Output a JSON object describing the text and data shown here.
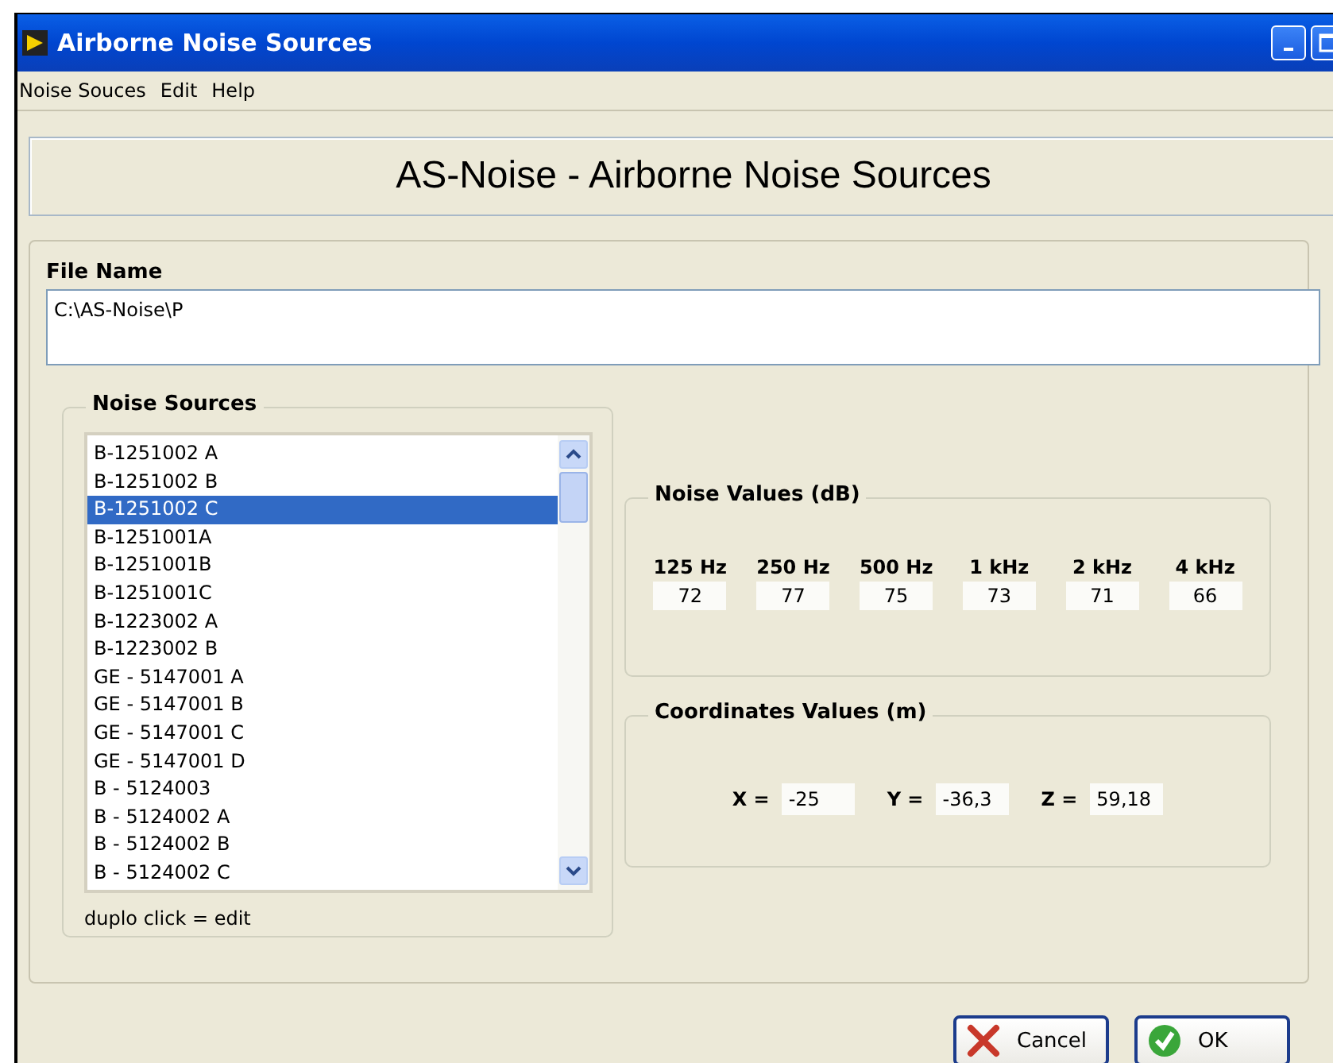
{
  "window": {
    "title": "Airborne Noise Sources"
  },
  "menu": [
    "Noise Souces",
    "Edit",
    "Help"
  ],
  "header": "AS-Noise - Airborne Noise Sources",
  "file_name": {
    "label": "File Name",
    "value": "C:\\AS-Noise\\P"
  },
  "noise_sources": {
    "title": "Noise Sources",
    "items": [
      {
        "label": "B-1251002 A",
        "selected": false
      },
      {
        "label": "B-1251002 B",
        "selected": false
      },
      {
        "label": "B-1251002 C",
        "selected": true
      },
      {
        "label": "B-1251001A",
        "selected": false
      },
      {
        "label": "B-1251001B",
        "selected": false
      },
      {
        "label": "B-1251001C",
        "selected": false
      },
      {
        "label": "B-1223002 A",
        "selected": false
      },
      {
        "label": "B-1223002 B",
        "selected": false
      },
      {
        "label": "GE - 5147001 A",
        "selected": false
      },
      {
        "label": "GE - 5147001 B",
        "selected": false
      },
      {
        "label": "GE - 5147001 C",
        "selected": false
      },
      {
        "label": "GE - 5147001 D",
        "selected": false
      },
      {
        "label": "B - 5124003",
        "selected": false
      },
      {
        "label": "B - 5124002 A",
        "selected": false
      },
      {
        "label": "B - 5124002 B",
        "selected": false
      },
      {
        "label": "B - 5124002 C",
        "selected": false
      }
    ],
    "hint": "duplo click = edit"
  },
  "noise_values": {
    "title": "Noise Values (dB)",
    "bands": [
      {
        "label": "125 Hz",
        "value": "72"
      },
      {
        "label": "250 Hz",
        "value": "77"
      },
      {
        "label": "500 Hz",
        "value": "75"
      },
      {
        "label": "1 kHz",
        "value": "73"
      },
      {
        "label": "2 kHz",
        "value": "71"
      },
      {
        "label": "4 kHz",
        "value": "66"
      }
    ]
  },
  "coordinates": {
    "title": "Coordinates Values (m)",
    "values": [
      {
        "label": "X =",
        "value": "-25"
      },
      {
        "label": "Y =",
        "value": "-36,3"
      },
      {
        "label": "Z =",
        "value": "59,18"
      }
    ]
  },
  "buttons": [
    {
      "kind": "cancel",
      "label": "Cancel"
    },
    {
      "kind": "ok",
      "label": "OK"
    }
  ]
}
